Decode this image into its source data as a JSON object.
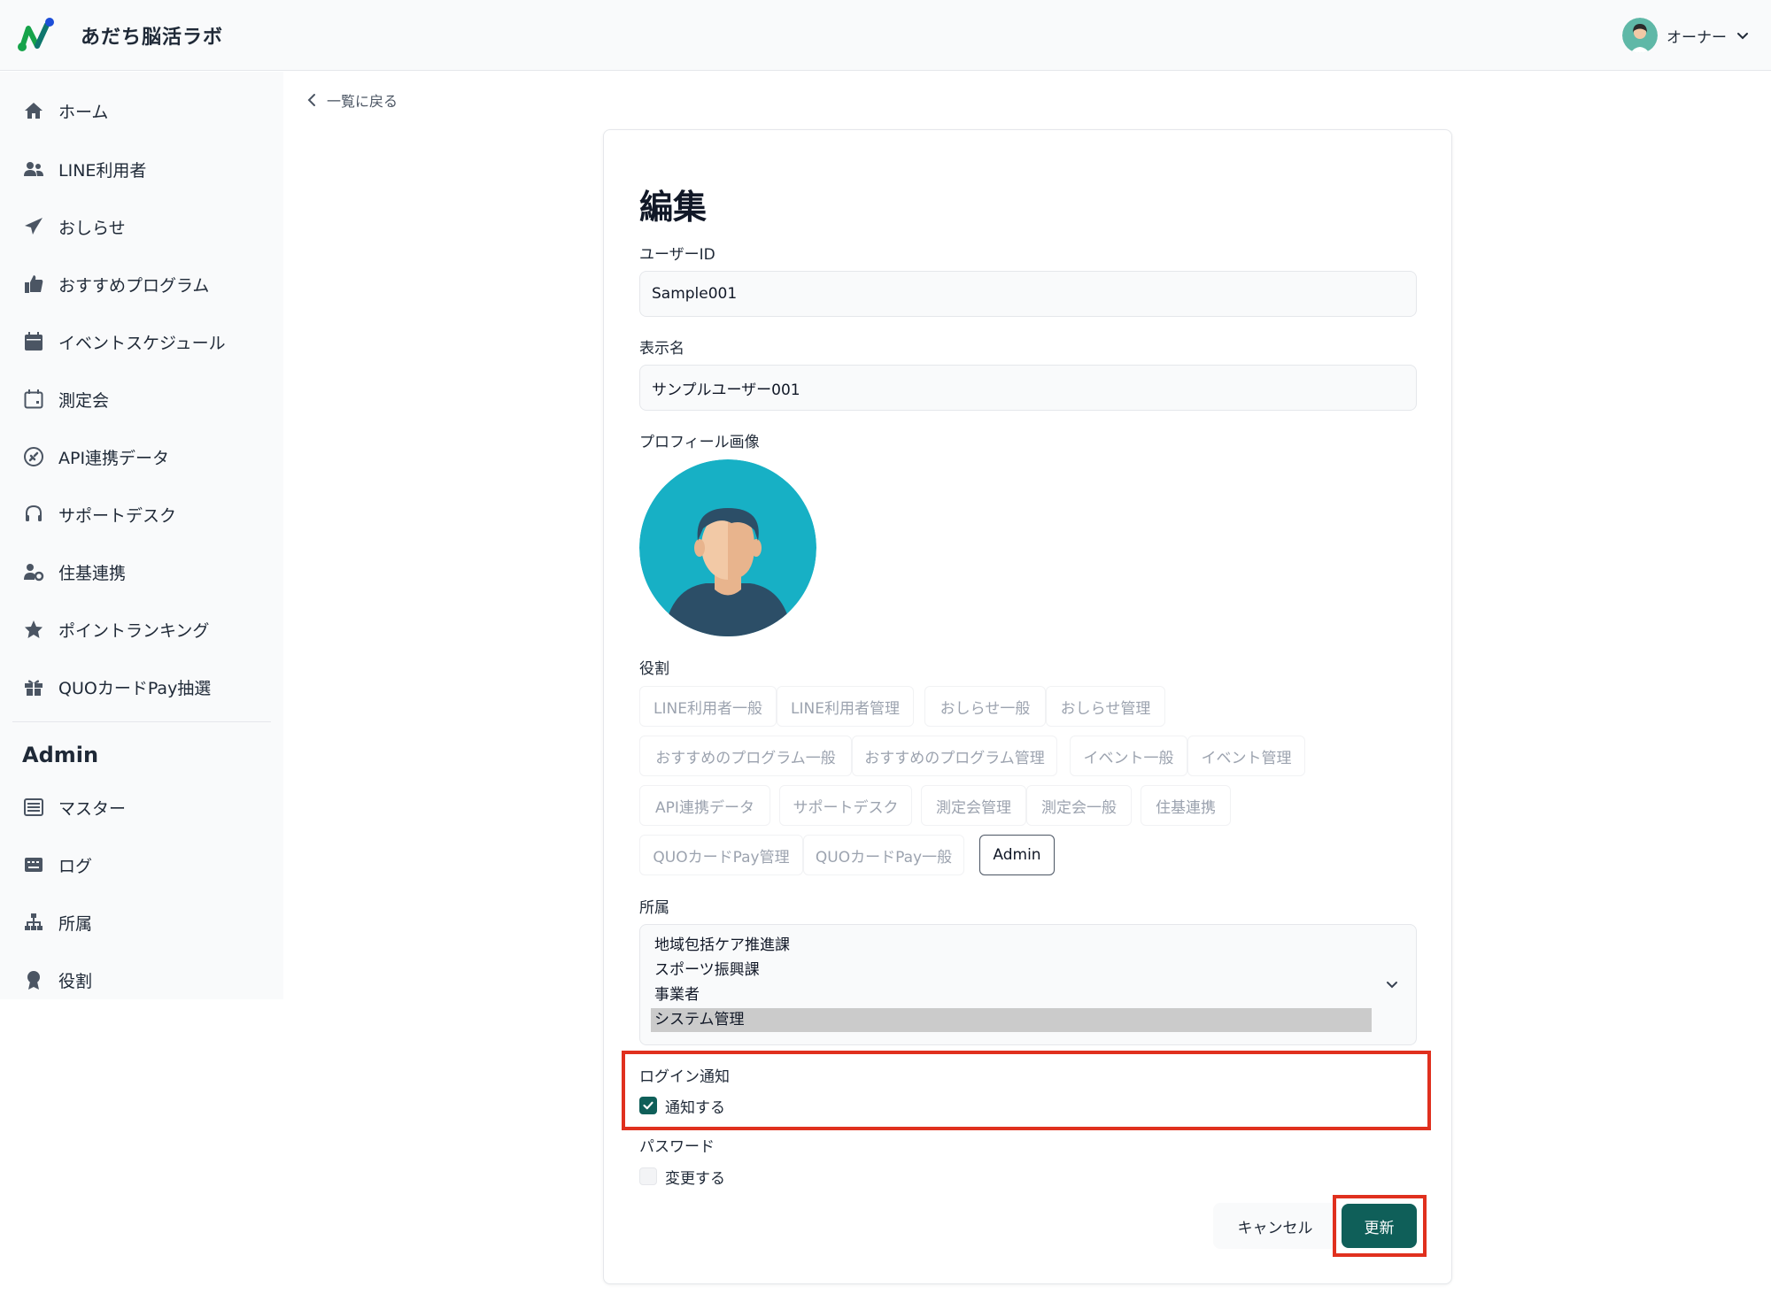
{
  "header": {
    "brand": "あだち脳活ラボ",
    "user_name": "オーナー"
  },
  "back_link": "一覧に戻る",
  "sidebar": {
    "items": [
      {
        "label": "ホーム",
        "icon": "home-icon"
      },
      {
        "label": "LINE利用者",
        "icon": "users-icon"
      },
      {
        "label": "おしらせ",
        "icon": "paper-plane-icon"
      },
      {
        "label": "おすすめプログラム",
        "icon": "thumbs-up-icon"
      },
      {
        "label": "イベントスケジュール",
        "icon": "calendar-icon"
      },
      {
        "label": "測定会",
        "icon": "calendar-outline-icon"
      },
      {
        "label": "API連携データ",
        "icon": "plug-circle-icon"
      },
      {
        "label": "サポートデスク",
        "icon": "headset-icon"
      },
      {
        "label": "住基連携",
        "icon": "user-gear-icon"
      },
      {
        "label": "ポイントランキング",
        "icon": "star-icon"
      },
      {
        "label": "QUOカードPay抽選",
        "icon": "gift-icon"
      }
    ],
    "admin_heading": "Admin",
    "admin_items": [
      {
        "label": "マスター",
        "icon": "server-icon"
      },
      {
        "label": "ログ",
        "icon": "keyboard-icon"
      },
      {
        "label": "所属",
        "icon": "sitemap-icon"
      },
      {
        "label": "役割",
        "icon": "award-icon"
      }
    ]
  },
  "form": {
    "title": "編集",
    "user_id_label": "ユーザーID",
    "user_id_value": "Sample001",
    "display_name_label": "表示名",
    "display_name_value": "サンプルユーザー001",
    "profile_image_label": "プロフィール画像",
    "roles_label": "役割",
    "roles": [
      {
        "label": "LINE利用者一般",
        "selected": false
      },
      {
        "label": "LINE利用者管理",
        "selected": false
      },
      {
        "label": "おしらせ一般",
        "selected": false
      },
      {
        "label": "おしらせ管理",
        "selected": false
      },
      {
        "label": "おすすめのプログラム一般",
        "selected": false
      },
      {
        "label": "おすすめのプログラム管理",
        "selected": false
      },
      {
        "label": "イベント一般",
        "selected": false
      },
      {
        "label": "イベント管理",
        "selected": false
      },
      {
        "label": "API連携データ",
        "selected": false
      },
      {
        "label": "サポートデスク",
        "selected": false
      },
      {
        "label": "測定会管理",
        "selected": false
      },
      {
        "label": "測定会一般",
        "selected": false
      },
      {
        "label": "住基連携",
        "selected": false
      },
      {
        "label": "QUOカードPay管理",
        "selected": false
      },
      {
        "label": "QUOカードPay一般",
        "selected": false
      },
      {
        "label": "Admin",
        "selected": true
      }
    ],
    "affiliation_label": "所属",
    "affiliation_options": [
      {
        "label": "地域包括ケア推進課",
        "selected": false
      },
      {
        "label": "スポーツ振興課",
        "selected": false
      },
      {
        "label": "事業者",
        "selected": false
      },
      {
        "label": "システム管理",
        "selected": true
      }
    ],
    "login_notify_label": "ログイン通知",
    "login_notify_checkbox_label": "通知する",
    "login_notify_checked": true,
    "password_label": "パスワード",
    "password_checkbox_label": "変更する",
    "password_checked": false,
    "cancel_label": "キャンセル",
    "update_label": "更新"
  },
  "colors": {
    "accent": "#0f5f59",
    "highlight": "#e0301e"
  }
}
